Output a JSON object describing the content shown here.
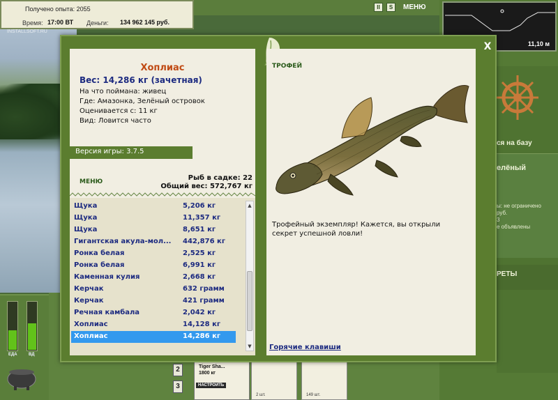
{
  "hud": {
    "experience_label": "Получено опыта: 2055",
    "time_label": "Время:",
    "time_value": "17:00 ВТ",
    "money_label": "Деньги:",
    "money_value": "134 962 145 руб.",
    "watermark": "INSTALLSOFT.RU",
    "menu_label": "МЕНЮ",
    "pause_icon_text": "II",
    "sound_icon_text": "S",
    "depth_value": "11,10 м"
  },
  "gauges": {
    "food_label": "ЕДА",
    "food_level": 0.4,
    "energy_label": "ВД",
    "energy_level": 0.55
  },
  "right_side": {
    "base_label": "ся на базу",
    "location_title": "елёный",
    "line1": "ы: не ограничено",
    "line2": "руб.",
    "line3": "3",
    "line4": "е объявлены",
    "secrets_label": "РЕТЫ"
  },
  "bottom": {
    "slot2": "2",
    "slot3": "3",
    "tackle_name": "Tiger Sha...",
    "tackle_weight": "1800 кг",
    "setup_button": "НАСТРОИТЬ",
    "bait1_count": "2 шт.",
    "bait2_count": "149 шт."
  },
  "dialog": {
    "close_label": "X",
    "fish": {
      "name": "Хоплиас",
      "weight": "Вес: 14,286 кг (зачетная)",
      "caught_on": "На что поймана: живец",
      "location": "Где: Амазонка, Зелёный островок",
      "valued_from": "Оценивается с: 11 кг",
      "species_status": "Вид: Ловится часто"
    },
    "version": "Версия игры: 3.7.5",
    "menu_link": "МЕНЮ",
    "keepnet_count": "Рыб в садке: 22",
    "keepnet_weight": "Общий вес: 572,767 кг",
    "catch_list": [
      {
        "name": "Щука",
        "weight": "5,206 кг"
      },
      {
        "name": "Щука",
        "weight": "11,357 кг"
      },
      {
        "name": "Щука",
        "weight": "8,651 кг"
      },
      {
        "name": "Гигантская акула-мол...",
        "weight": "442,876 кг"
      },
      {
        "name": "Ронка белая",
        "weight": "2,525 кг"
      },
      {
        "name": "Ронка белая",
        "weight": "6,991 кг"
      },
      {
        "name": "Каменная кулия",
        "weight": "2,668 кг"
      },
      {
        "name": "Керчак",
        "weight": "632 грамм"
      },
      {
        "name": "Керчак",
        "weight": "421 грамм"
      },
      {
        "name": "Речная камбала",
        "weight": "2,042 кг"
      },
      {
        "name": "Хоплиас",
        "weight": "14,128 кг"
      },
      {
        "name": "Хоплиас",
        "weight": "14,286 кг"
      }
    ],
    "selected_index": 11,
    "trophy_label": "ТРОФЕЙ",
    "trophy_message": "Трофейный экземпляр! Кажется, вы открыли секрет успешной ловли!",
    "hotkeys_link": "Горячие клавиши"
  }
}
